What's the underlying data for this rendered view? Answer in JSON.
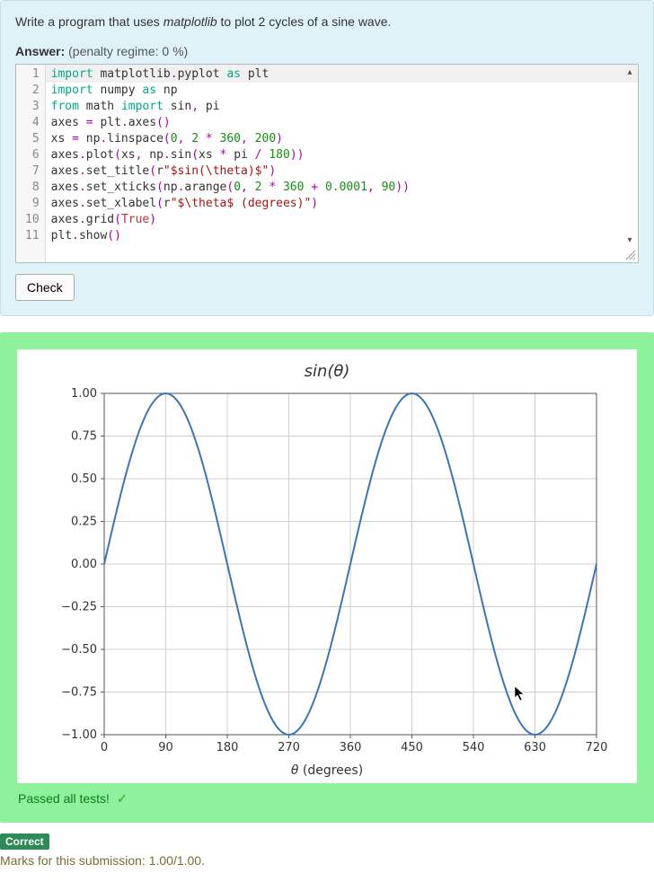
{
  "question": {
    "prompt_prefix": "Write a program that uses ",
    "prompt_em": "matplotlib",
    "prompt_suffix": " to plot 2 cycles of a sine wave.",
    "answer_label": "Answer:",
    "penalty": "(penalty regime: 0 %)"
  },
  "code_lines": [
    "import matplotlib.pyplot as plt",
    "import numpy as np",
    "from math import sin, pi",
    "axes = plt.axes()",
    "xs = np.linspace(0, 2 * 360, 200)",
    "axes.plot(xs, np.sin(xs * pi / 180))",
    "axes.set_title(r\"$sin(\\theta)$\")",
    "axes.set_xticks(np.arange(0, 2 * 360 + 0.0001, 90))",
    "axes.set_xlabel(r\"$\\theta$ (degrees)\")",
    "axes.grid(True)",
    "plt.show()"
  ],
  "check_button": "Check",
  "result": {
    "passed_text": "Passed all tests!",
    "correct_badge": "Correct",
    "marks_text": "Marks for this submission: 1.00/1.00."
  },
  "chart_data": {
    "type": "line",
    "title": "sin(θ)",
    "xlabel": "θ (degrees)",
    "ylabel": "",
    "xlim": [
      0,
      720
    ],
    "ylim": [
      -1.0,
      1.0
    ],
    "xticks": [
      0,
      90,
      180,
      270,
      360,
      450,
      540,
      630,
      720
    ],
    "yticks": [
      -1.0,
      -0.75,
      -0.5,
      -0.25,
      0.0,
      0.25,
      0.5,
      0.75,
      1.0
    ],
    "ytick_labels": [
      "−1.00",
      "−0.75",
      "−0.50",
      "−0.25",
      "0.00",
      "0.25",
      "0.50",
      "0.75",
      "1.00"
    ],
    "series": [
      {
        "name": "sin(θ)",
        "color": "#3a76b5",
        "x_range": [
          0,
          720
        ],
        "n_points": 200,
        "function": "sin_deg"
      }
    ],
    "grid": true,
    "cursor_deg": {
      "x": 600,
      "y": -0.72
    }
  }
}
